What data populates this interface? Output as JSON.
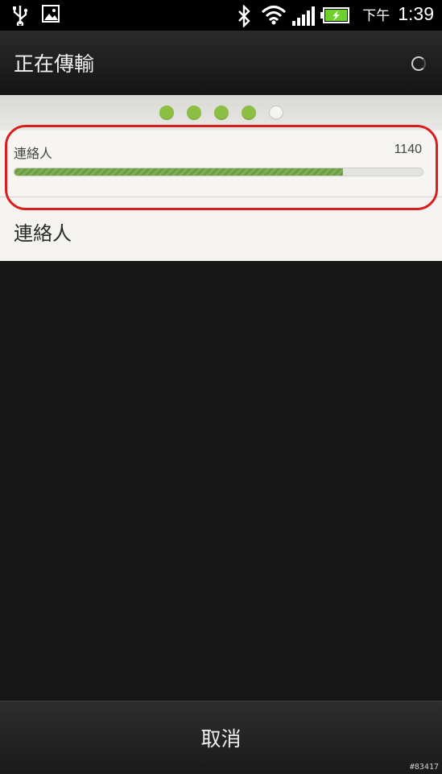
{
  "status_bar": {
    "icons": [
      "usb-icon",
      "image-icon",
      "bluetooth-icon",
      "wifi-icon",
      "signal-icon",
      "battery-charging-icon"
    ],
    "ampm": "下午",
    "time": "1:39"
  },
  "title_bar": {
    "title": "正在傳輸"
  },
  "page_indicator": {
    "total": 5,
    "filled": 4,
    "active_color": "#8dbf45"
  },
  "transfer_item": {
    "label": "連絡人",
    "count": "1140",
    "progress": 0.805,
    "progress_color": "#76a64c"
  },
  "section": {
    "title": "連絡人"
  },
  "footer": {
    "cancel_label": "取消"
  },
  "annotation": {
    "highlight_color": "#d81e1e"
  },
  "watermark": "#83417"
}
